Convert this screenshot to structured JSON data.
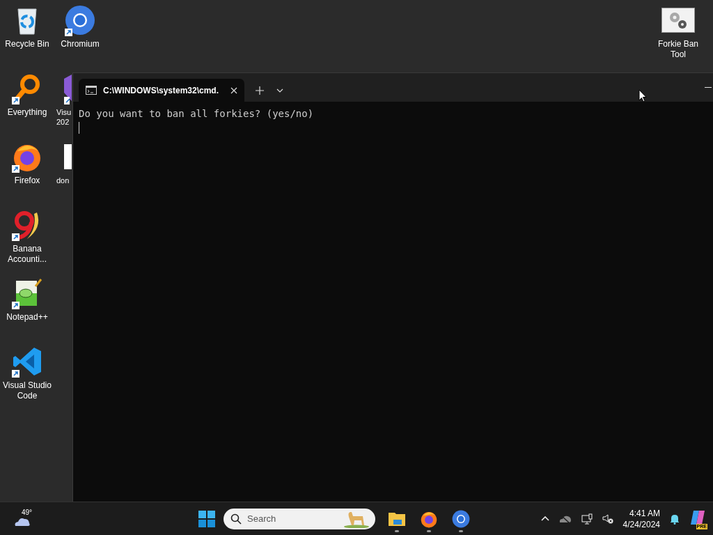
{
  "desktop_columns": [
    {
      "icons": [
        {
          "label": "Recycle Bin",
          "kind": "recycle",
          "shortcut": false
        },
        {
          "label": "Everything",
          "kind": "everything",
          "shortcut": true
        },
        {
          "label": "Firefox",
          "kind": "firefox",
          "shortcut": true
        },
        {
          "label": "Banana Accounti...",
          "kind": "banana",
          "shortcut": true
        },
        {
          "label": "Notepad++",
          "kind": "notepad",
          "shortcut": true
        },
        {
          "label": "Visual Studio Code",
          "kind": "vscode",
          "shortcut": true
        }
      ]
    },
    {
      "icons": [
        {
          "label": "Chromium",
          "kind": "chromium",
          "shortcut": true
        },
        {
          "label": "Visu 202",
          "kind": "visualstudio",
          "shortcut": true
        },
        {
          "label": "don",
          "kind": "document",
          "shortcut": false
        }
      ]
    }
  ],
  "desktop_right_icons": [
    {
      "label": "Forkie Ban Tool",
      "kind": "gears",
      "shortcut": false
    }
  ],
  "terminal": {
    "tab_title": "C:\\WINDOWS\\system32\\cmd.",
    "lines": [
      "Do you want to ban all forkies? (yes/no)"
    ]
  },
  "taskbar": {
    "weather": "49°",
    "search": {
      "placeholder": "Search"
    },
    "apps": [
      {
        "kind": "explorer",
        "running": true
      },
      {
        "kind": "firefox",
        "running": true
      },
      {
        "kind": "chromium",
        "running": true
      }
    ],
    "time": "4:41 AM",
    "date": "4/24/2024",
    "copilot_badge": "PRE"
  }
}
